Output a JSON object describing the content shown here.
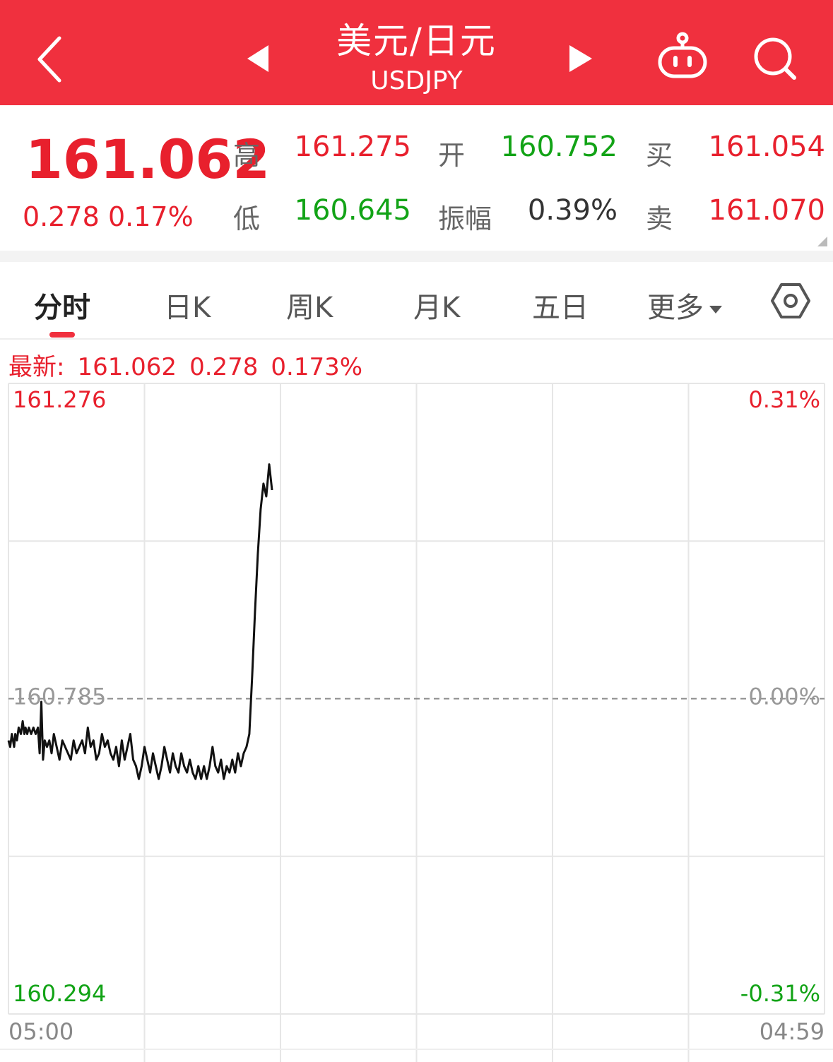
{
  "header": {
    "title": "美元/日元",
    "code": "USDJPY",
    "colors": {
      "background": "#f0303e"
    },
    "icons": [
      "back-chevron-icon",
      "prev-triangle-icon",
      "next-triangle-icon",
      "robot-icon",
      "search-icon"
    ]
  },
  "quote": {
    "price": "161.062",
    "change": "0.278",
    "change_pct": "0.17%",
    "labels": {
      "high": "高",
      "low": "低",
      "open": "开",
      "amplitude": "振幅",
      "buy": "买",
      "sell": "卖"
    },
    "high": "161.275",
    "low": "160.645",
    "open": "160.752",
    "amplitude": "0.39%",
    "buy": "161.054",
    "sell": "161.070"
  },
  "tabs": [
    {
      "label": "分时",
      "active": true
    },
    {
      "label": "日K"
    },
    {
      "label": "周K"
    },
    {
      "label": "月K"
    },
    {
      "label": "五日"
    },
    {
      "label": "更多"
    }
  ],
  "latest": {
    "label": "最新:",
    "price": "161.062",
    "change": "0.278",
    "change_pct": "0.173%"
  },
  "chart_data": {
    "type": "line",
    "ylim": [
      160.294,
      161.276
    ],
    "reference": 160.785,
    "y_labels_left": [
      "161.276",
      "160.785",
      "160.294"
    ],
    "y_labels_right": [
      "0.31%",
      "0.00%",
      "-0.31%"
    ],
    "x_labels": [
      "05:00",
      "04:59"
    ],
    "x_range": [
      0,
      1440
    ],
    "series": [
      {
        "x": [
          0,
          3,
          6,
          10,
          12,
          15,
          18,
          22,
          25,
          28,
          30,
          33,
          36,
          40,
          44,
          48,
          52,
          55,
          58,
          61,
          64,
          68,
          72,
          76,
          80,
          85,
          90,
          95,
          100,
          105,
          110,
          115,
          120,
          125,
          130,
          135,
          140,
          145,
          150,
          155,
          160,
          165,
          170,
          175,
          180,
          185,
          190,
          195,
          200,
          205,
          210,
          215,
          220,
          225,
          230,
          235,
          240,
          245,
          250,
          255,
          260,
          265,
          270,
          275,
          280,
          285,
          290,
          295,
          300,
          305,
          310,
          315,
          320,
          325,
          330,
          335,
          340,
          345,
          350,
          355,
          360,
          365,
          370,
          375,
          380,
          385,
          390,
          395,
          400,
          405,
          410,
          415,
          420,
          425,
          430,
          435,
          440,
          445,
          450,
          455,
          460,
          465
        ],
        "values": [
          160.72,
          160.71,
          160.73,
          160.71,
          160.73,
          160.72,
          160.74,
          160.73,
          160.75,
          160.73,
          160.74,
          160.73,
          160.74,
          160.73,
          160.74,
          160.73,
          160.74,
          160.7,
          160.78,
          160.69,
          160.72,
          160.71,
          160.72,
          160.7,
          160.73,
          160.71,
          160.69,
          160.72,
          160.71,
          160.7,
          160.69,
          160.72,
          160.7,
          160.71,
          160.72,
          160.7,
          160.74,
          160.71,
          160.72,
          160.69,
          160.7,
          160.73,
          160.71,
          160.72,
          160.7,
          160.69,
          160.71,
          160.68,
          160.72,
          160.69,
          160.71,
          160.73,
          160.69,
          160.68,
          160.66,
          160.68,
          160.71,
          160.69,
          160.67,
          160.7,
          160.68,
          160.66,
          160.68,
          160.71,
          160.69,
          160.67,
          160.7,
          160.68,
          160.67,
          160.7,
          160.68,
          160.67,
          160.69,
          160.67,
          160.66,
          160.68,
          160.66,
          160.68,
          160.66,
          160.68,
          160.71,
          160.68,
          160.67,
          160.69,
          160.66,
          160.68,
          160.67,
          160.69,
          160.67,
          160.7,
          160.68,
          160.7,
          160.71,
          160.73,
          160.82,
          160.92,
          161.01,
          161.08,
          161.12,
          161.1,
          161.15,
          161.11
        ]
      }
    ]
  }
}
